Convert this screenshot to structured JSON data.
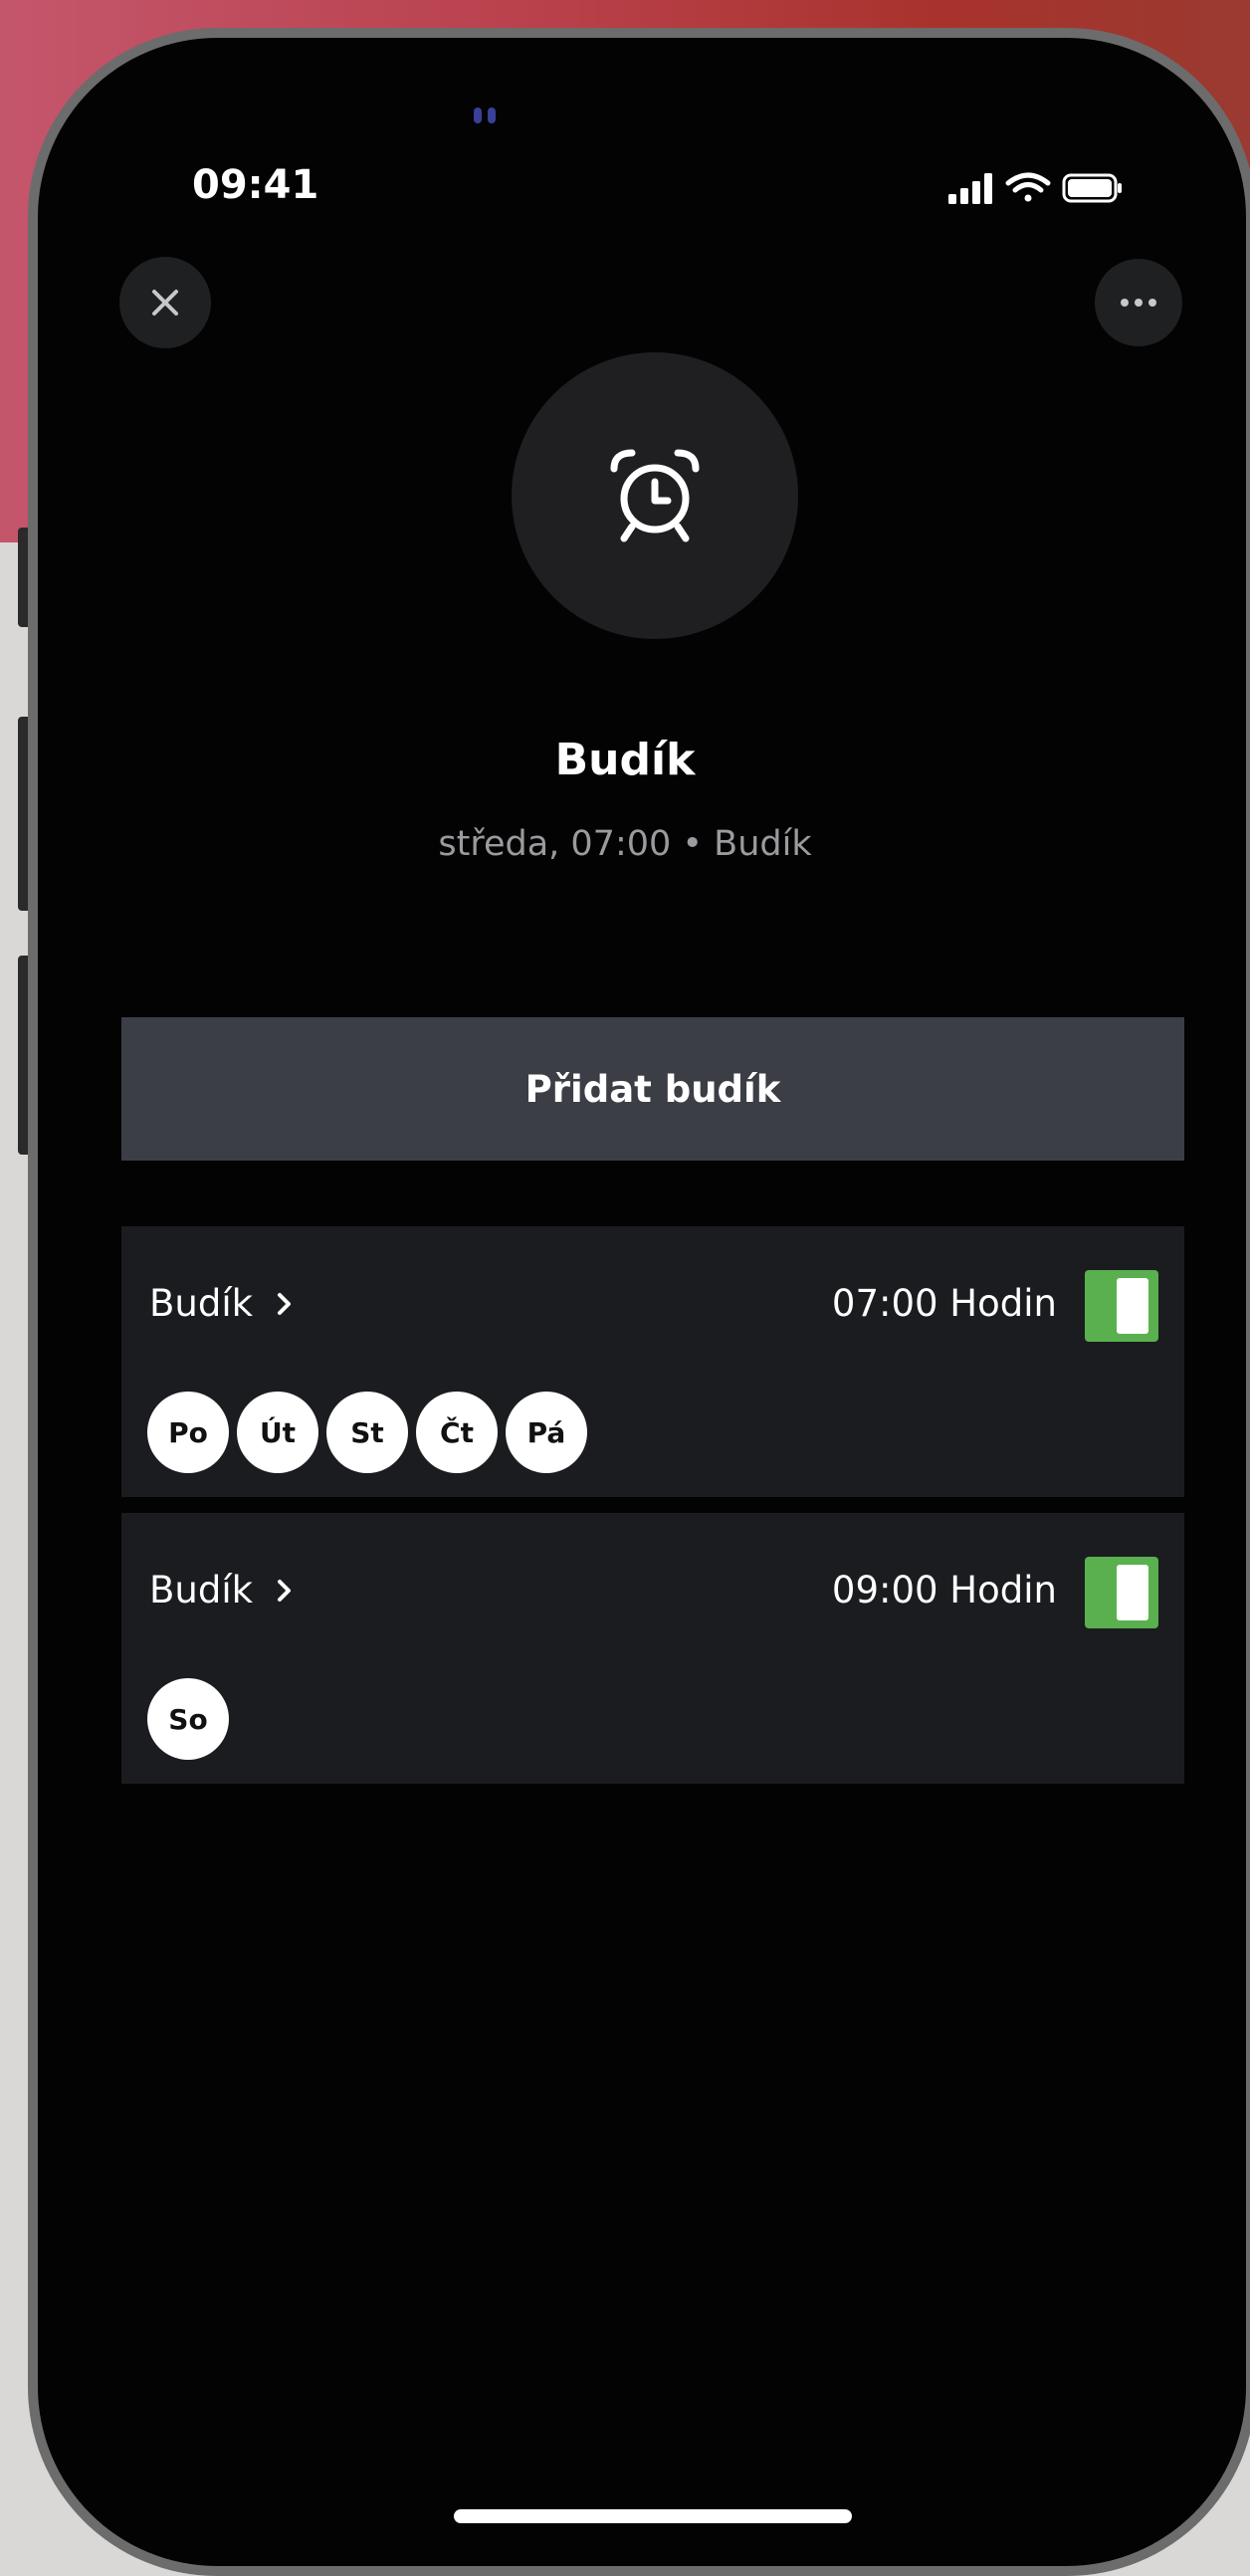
{
  "status_bar": {
    "time": "09:41"
  },
  "header": {
    "close_icon": "close-icon",
    "more_icon": "more-horizontal-icon"
  },
  "hero": {
    "icon": "alarm-clock-icon",
    "title": "Budík",
    "subtitle": "středa, 07:00 • Budík"
  },
  "actions": {
    "add_alarm_label": "Přidat budík"
  },
  "alarms": [
    {
      "name": "Budík",
      "time": "07:00 Hodin",
      "enabled": true,
      "days": [
        "Po",
        "Út",
        "St",
        "Čt",
        "Pá"
      ]
    },
    {
      "name": "Budík",
      "time": "09:00 Hodin",
      "enabled": true,
      "days": [
        "So"
      ]
    }
  ],
  "colors": {
    "toggle_on": "#5ab04f",
    "card_bg": "#1b1c20",
    "button_bg": "#3b3e45",
    "screen_bg": "#030303"
  }
}
